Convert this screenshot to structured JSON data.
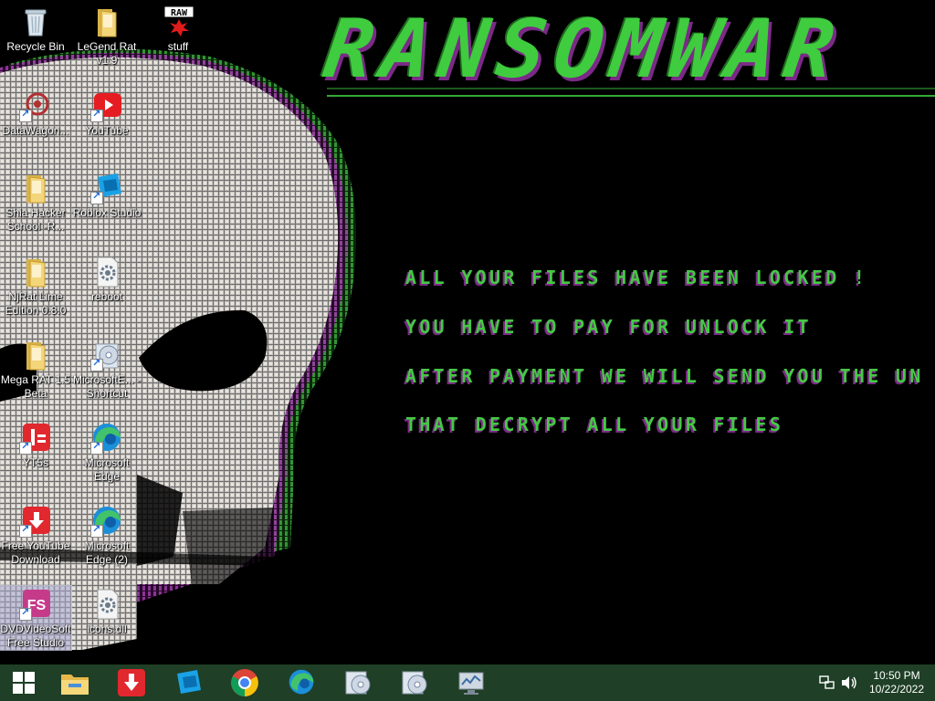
{
  "wallpaper": {
    "title": "RANSOMWAR",
    "lines": [
      "ALL YOUR FILES HAVE BEEN LOCKED !",
      "YOU HAVE TO PAY FOR UNLOCK IT",
      "AFTER PAYMENT WE WILL SEND YOU THE UN",
      "THAT DECRYPT ALL YOUR FILES"
    ]
  },
  "desktop": {
    "icons": [
      {
        "label": "Recycle Bin",
        "icon": "recycle-bin-icon"
      },
      {
        "label": "LeGend Rat v1.9",
        "icon": "folder-icon"
      },
      {
        "label": "stuff",
        "icon": "raw-file-icon",
        "badge": "RAW"
      },
      {
        "label": "DataWagon...",
        "icon": "datawagon-icon"
      },
      {
        "label": "YouTube",
        "icon": "youtube-icon"
      },
      {
        "label": "Shia Hacker School -R...",
        "icon": "folder-icon"
      },
      {
        "label": "Roblox Studio",
        "icon": "roblox-studio-icon"
      },
      {
        "label": "NjRat Lime Edition 0.8.0",
        "icon": "folder-icon"
      },
      {
        "label": "reboot",
        "icon": "settings-file-icon"
      },
      {
        "label": "Mega RAT 1.5 Beta",
        "icon": "folder-icon"
      },
      {
        "label": "MicrosoftE... - Shortcut",
        "icon": "disc-shortcut-icon"
      },
      {
        "label": "YT5s",
        "icon": "yt5s-icon"
      },
      {
        "label": "Microsoft Edge",
        "icon": "edge-icon"
      },
      {
        "label": "Free YouTube Download",
        "icon": "free-youtube-download-icon"
      },
      {
        "label": "Microsoft Edge (2)",
        "icon": "edge-icon"
      },
      {
        "label": "DVDVideoSoft Free Studio",
        "icon": "dvdvideosoft-icon",
        "badge": "FS"
      },
      {
        "label": "icons.dll",
        "icon": "dll-file-icon"
      }
    ]
  },
  "taskbar": {
    "apps": [
      "start",
      "file-explorer",
      "free-youtube-download",
      "roblox-studio",
      "chrome",
      "edge",
      "disc-tool",
      "disc-tool-2",
      "monitor-tool"
    ],
    "clock": {
      "time": "10:50 PM",
      "date": "10/22/2022"
    }
  },
  "colors": {
    "green": "#3fcc3f",
    "purple": "#7a2a86",
    "taskbar": "#1f3f26"
  }
}
